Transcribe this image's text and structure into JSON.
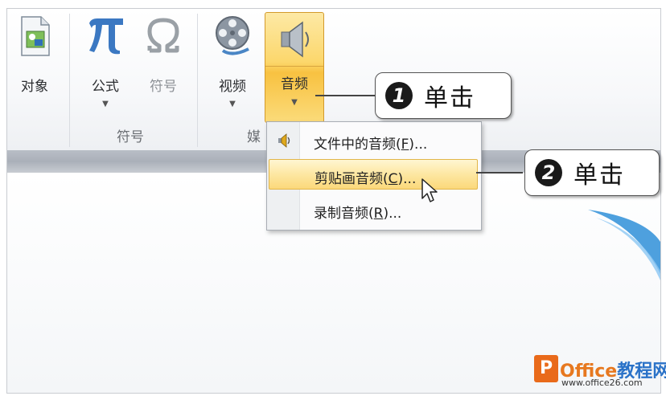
{
  "ribbon": {
    "buttons": {
      "object": "对象",
      "formula": "公式",
      "symbol": "符号",
      "video": "视频",
      "audio": "音频"
    },
    "groups": {
      "symbols": "符号",
      "media": "媒"
    },
    "icons": {
      "object": "object-icon",
      "formula": "pi-icon",
      "symbol": "omega-icon",
      "video": "film-reel-icon",
      "audio": "speaker-icon"
    }
  },
  "audio_menu": {
    "items": [
      {
        "label": "文件中的音频(",
        "accel": "F",
        "suffix": ")...",
        "icon": "speaker-icon"
      },
      {
        "label": "剪贴画音频(",
        "accel": "C",
        "suffix": ")...",
        "highlighted": true
      },
      {
        "label": "录制音频(",
        "accel": "R",
        "suffix": ")..."
      }
    ]
  },
  "callouts": [
    {
      "number": "1",
      "text": "单击"
    },
    {
      "number": "2",
      "text": "单击"
    }
  ],
  "watermark": {
    "logo_letter": "P",
    "brand_prefix": "Office",
    "brand_suffix": "教程网",
    "site": "www.office26.com"
  },
  "colors": {
    "accent_orange": "#e96a1a",
    "highlight_gold": "#fbd87a",
    "swoosh_blue": "#2f8fd8"
  }
}
